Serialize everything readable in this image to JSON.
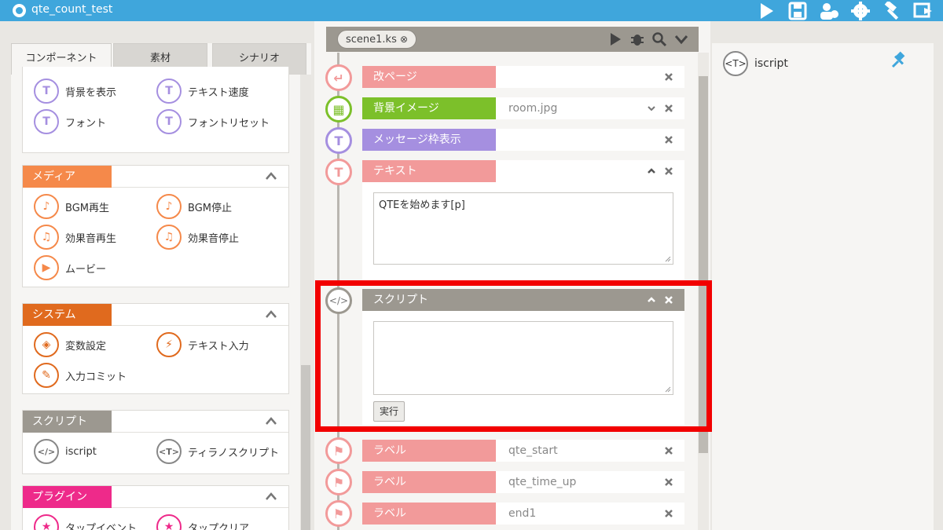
{
  "window": {
    "title": "qte_count_test"
  },
  "left": {
    "tabs": [
      {
        "label": "コンポーネント"
      },
      {
        "label": "素材"
      },
      {
        "label": "シナリオ"
      }
    ],
    "top_items": [
      {
        "label": "背景を表示",
        "icon": "bg-show-icon"
      },
      {
        "label": "テキスト速度",
        "icon": "text-speed-icon"
      },
      {
        "label": "フォント",
        "icon": "font-icon"
      },
      {
        "label": "フォントリセット",
        "icon": "font-reset-icon"
      }
    ],
    "groups": {
      "media": {
        "label": "メディア",
        "color": "#f5894a",
        "items": [
          {
            "label": "BGM再生"
          },
          {
            "label": "BGM停止"
          },
          {
            "label": "効果音再生"
          },
          {
            "label": "効果音停止"
          },
          {
            "label": "ムービー"
          }
        ]
      },
      "system": {
        "label": "システム",
        "color": "#e06a1e",
        "items": [
          {
            "label": "変数設定"
          },
          {
            "label": "テキスト入力"
          },
          {
            "label": "入力コミット"
          }
        ]
      },
      "script": {
        "label": "スクリプト",
        "color": "#9c9890",
        "items": [
          {
            "label": "iscript",
            "glyph": "</>"
          },
          {
            "label": "ティラノスクリプト",
            "glyph": "<T>"
          }
        ]
      },
      "plugin": {
        "label": "プラグイン",
        "color": "#ee2a8a",
        "items": [
          {
            "label": "タップイベント"
          },
          {
            "label": "タップクリア"
          }
        ]
      }
    }
  },
  "editor": {
    "file_tab": "scene1.ks",
    "rows": {
      "page": {
        "label": "改ページ",
        "color": "#f29a9a"
      },
      "bg": {
        "label": "背景イメージ",
        "value": "room.jpg",
        "color": "#7cc02a"
      },
      "msg": {
        "label": "メッセージ枠表示",
        "color": "#a58fe0"
      },
      "text": {
        "label": "テキスト",
        "color": "#f29a9a",
        "content": "QTEを始めます[p]"
      },
      "script": {
        "label": "スクリプト",
        "color": "#9c9890",
        "content": "",
        "exec_label": "実行"
      },
      "label1": {
        "label": "ラベル",
        "value": "qte_start",
        "color": "#f29a9a"
      },
      "label2": {
        "label": "ラベル",
        "value": "qte_time_up",
        "color": "#f29a9a"
      },
      "label3": {
        "label": "ラベル",
        "value": "end1",
        "color": "#f29a9a"
      }
    }
  },
  "right": {
    "item": {
      "label": "iscript",
      "glyph": "<T>"
    }
  },
  "highlight_color": "#f20000"
}
